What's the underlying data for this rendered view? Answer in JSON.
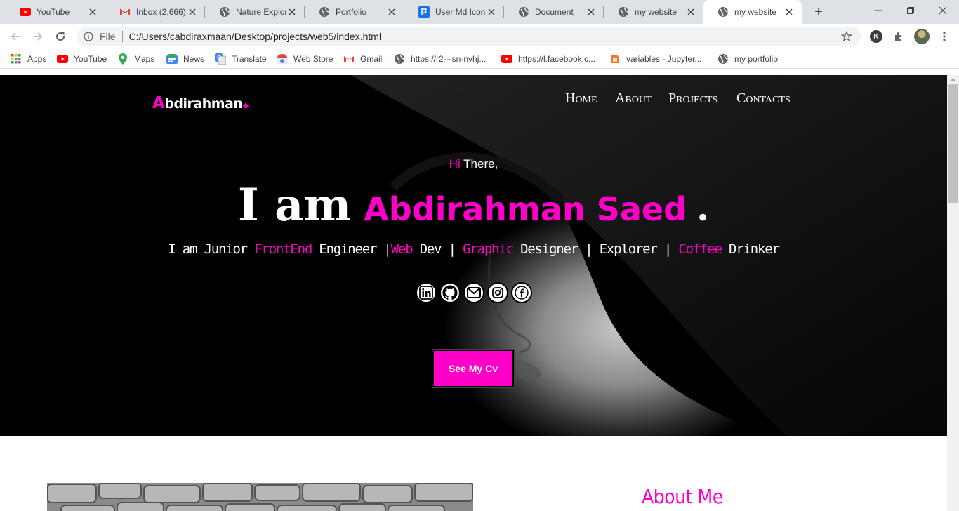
{
  "browser": {
    "tabs": [
      {
        "title": "YouTube",
        "icon": "youtube-icon"
      },
      {
        "title": "Inbox (2,666) -",
        "icon": "gmail-icon"
      },
      {
        "title": "Nature Explora",
        "icon": "globe-icon"
      },
      {
        "title": "Portfolio",
        "icon": "globe-icon"
      },
      {
        "title": "User Md Icon |",
        "icon": "flag-icon"
      },
      {
        "title": "Document",
        "icon": "globe-icon"
      },
      {
        "title": "my website",
        "icon": "globe-icon"
      },
      {
        "title": "my website",
        "icon": "globe-icon",
        "active": true
      }
    ],
    "new_tab": "+",
    "address": {
      "scheme_label": "File",
      "url": "C:/Users/cabdiraxmaan/Desktop/projects/web5/index.html"
    },
    "profile_initial": "K",
    "bookmarks": [
      {
        "label": "Apps",
        "icon": "apps-grid-icon"
      },
      {
        "label": "YouTube",
        "icon": "youtube-icon"
      },
      {
        "label": "Maps",
        "icon": "maps-pin-icon"
      },
      {
        "label": "News",
        "icon": "news-icon"
      },
      {
        "label": "Translate",
        "icon": "translate-icon"
      },
      {
        "label": "Web Store",
        "icon": "webstore-icon"
      },
      {
        "label": "Gmail",
        "icon": "gmail-icon"
      },
      {
        "label": "https://r2---sn-nvhj...",
        "icon": "globe-icon"
      },
      {
        "label": "https://l.facebook.c...",
        "icon": "youtube-icon"
      },
      {
        "label": "variables - Jupyter...",
        "icon": "jupyter-icon"
      },
      {
        "label": "my portfolio",
        "icon": "globe-icon"
      }
    ]
  },
  "site": {
    "logo": {
      "first": "A",
      "rest": "bdirahman"
    },
    "nav": [
      "Home",
      "About",
      "Projects",
      "Contacts"
    ],
    "greeting": {
      "hi": "Hi",
      "rest": " There,"
    },
    "headline": {
      "prefix": "I am",
      "name": "Abdirahman Saed",
      "suffix": "."
    },
    "subtitle": [
      {
        "t": "I am Junior ",
        "hl": false
      },
      {
        "t": "FrontEnd",
        "hl": true
      },
      {
        "t": " Engineer |",
        "hl": false
      },
      {
        "t": "Web",
        "hl": true
      },
      {
        "t": " Dev | ",
        "hl": false
      },
      {
        "t": "Graphic",
        "hl": true
      },
      {
        "t": " Designer | Explorer | ",
        "hl": false
      },
      {
        "t": "Coffee",
        "hl": true
      },
      {
        "t": " Drinker",
        "hl": false
      }
    ],
    "socials": [
      "linkedin-icon",
      "github-icon",
      "email-icon",
      "instagram-icon",
      "facebook-icon"
    ],
    "cv_button": "See My Cv",
    "about_heading": "About Me"
  },
  "colors": {
    "accent": "#ff00c8",
    "hero_bg": "#000000"
  }
}
